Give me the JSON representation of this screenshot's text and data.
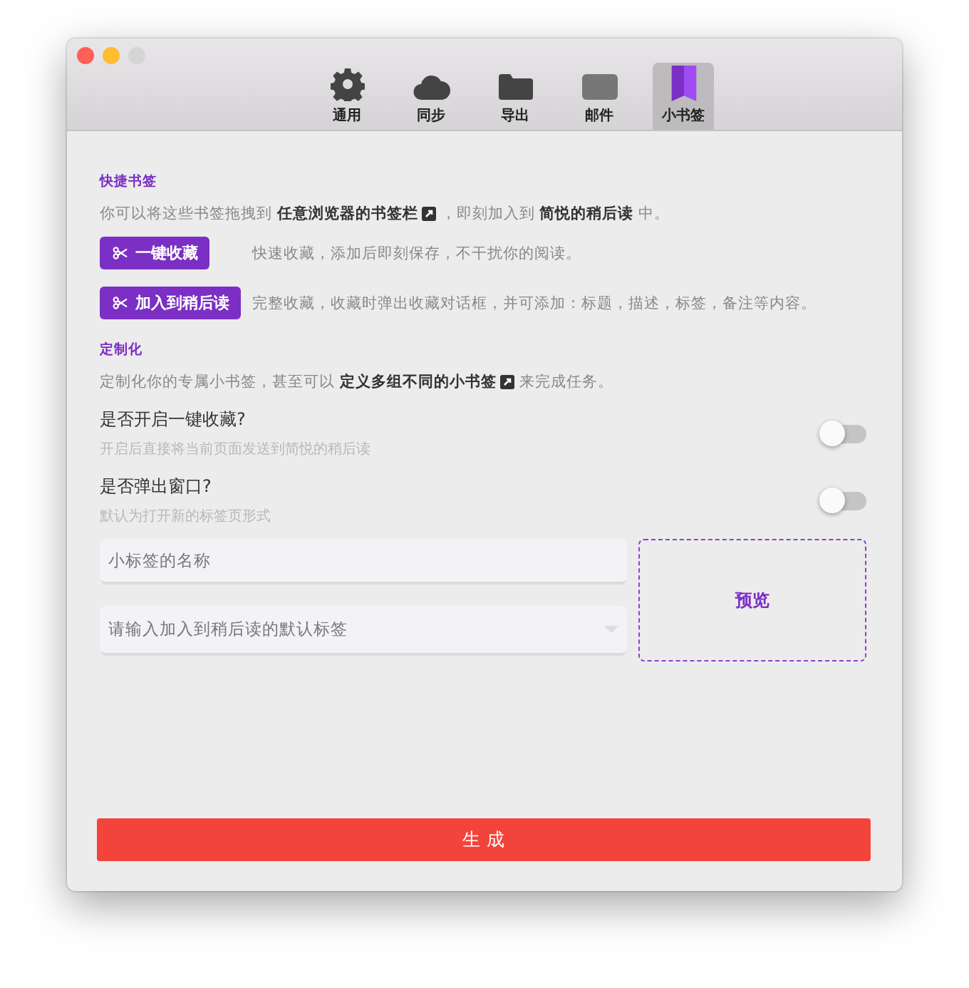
{
  "tabs": [
    {
      "label": "通用",
      "kind": "gear",
      "selected": false
    },
    {
      "label": "同步",
      "kind": "cloud",
      "selected": false
    },
    {
      "label": "导出",
      "kind": "folder",
      "selected": false
    },
    {
      "label": "邮件",
      "kind": "mail",
      "selected": false
    },
    {
      "label": "小书签",
      "kind": "bookmark",
      "selected": true
    }
  ],
  "quick": {
    "title": "快捷书签",
    "intro_before": "你可以将这些书签拖拽到 **任意浏览器的书签栏**",
    "intro_after": "，即刻加入到 **简悦的稍后读** 中。",
    "bookmarklets": [
      {
        "label": "一键收藏",
        "description": "快速收藏，添加后即刻保存，不干扰你的阅读。"
      },
      {
        "label": "加入到稍后读",
        "description": "完整收藏，收藏时弹出收藏对话框，并可添加：标题，描述，标签，备注等内容。"
      }
    ]
  },
  "custom": {
    "title": "定制化",
    "intro_before": "定制化你的专属小书签，甚至可以 **定义多组不同的小书签**",
    "intro_after": "来完成任务。",
    "toggles": [
      {
        "label": "是否开启一键收藏?",
        "hint": "开启后直接将当前页面发送到简悦的稍后读",
        "on": false
      },
      {
        "label": "是否弹出窗口?",
        "hint": "默认为打开新的标签页形式",
        "on": false
      }
    ],
    "name_field": {
      "placeholder": "小标签的名称"
    },
    "tag_field": {
      "placeholder": "请输入加入到稍后读的默认标签"
    },
    "preview": "预览"
  },
  "generate_button": "生 成"
}
